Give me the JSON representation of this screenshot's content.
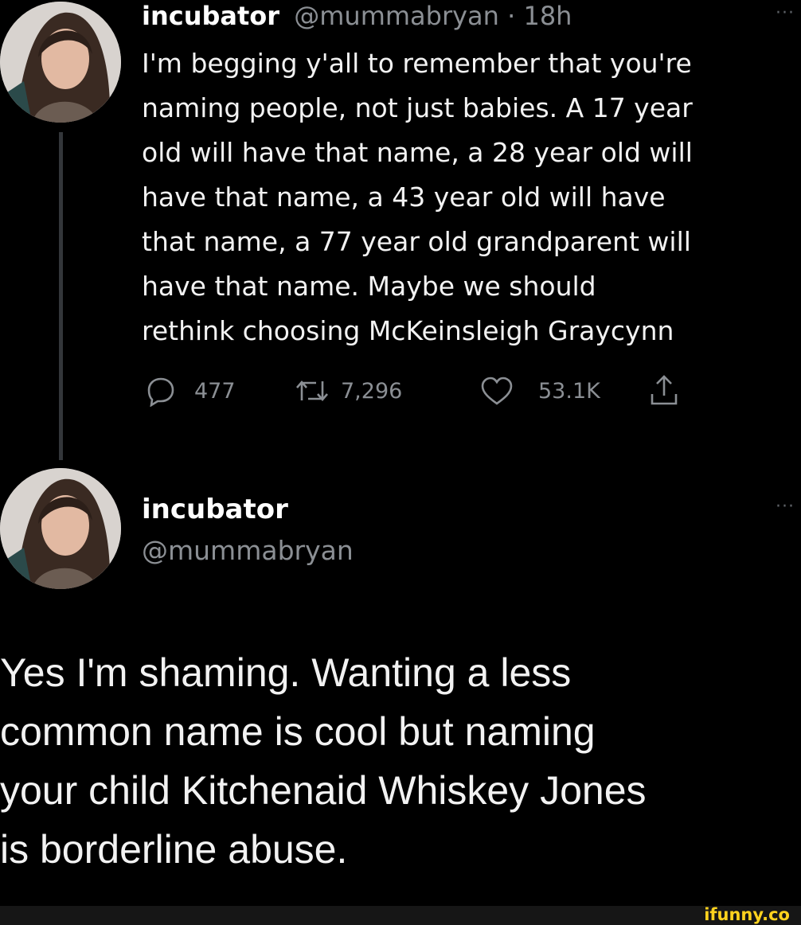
{
  "tweet": {
    "display_name": "incubator",
    "handle_time": "@mummabryan · 18h",
    "more": "···",
    "lines": [
      "I'm begging y'all to remember that you're",
      "naming people, not just babies. A 17 year",
      "old will have that name, a 28 year old will",
      "have that name, a 43 year old will have",
      "that name, a 77 year old grandparent will",
      "have that name. Maybe we should",
      "rethink choosing McKeinsleigh Graycynn"
    ],
    "stats": {
      "replies": "477",
      "retweets": "7,296",
      "likes": "53.1K"
    }
  },
  "reply": {
    "display_name": "incubator",
    "handle": "@mummabryan",
    "more": "···",
    "lines": [
      "Yes I'm shaming. Wanting a less",
      "common name is cool but naming",
      "your child Kitchenaid Whiskey Jones",
      "is borderline abuse."
    ]
  },
  "watermark": "ifunny.co",
  "colors": {
    "background": "#000000",
    "text": "#f2f2f2",
    "secondary": "#8b8f94",
    "watermark": "#ffd21e"
  },
  "icons": [
    "reply-icon",
    "retweet-icon",
    "like-icon",
    "share-icon",
    "more-icon"
  ]
}
